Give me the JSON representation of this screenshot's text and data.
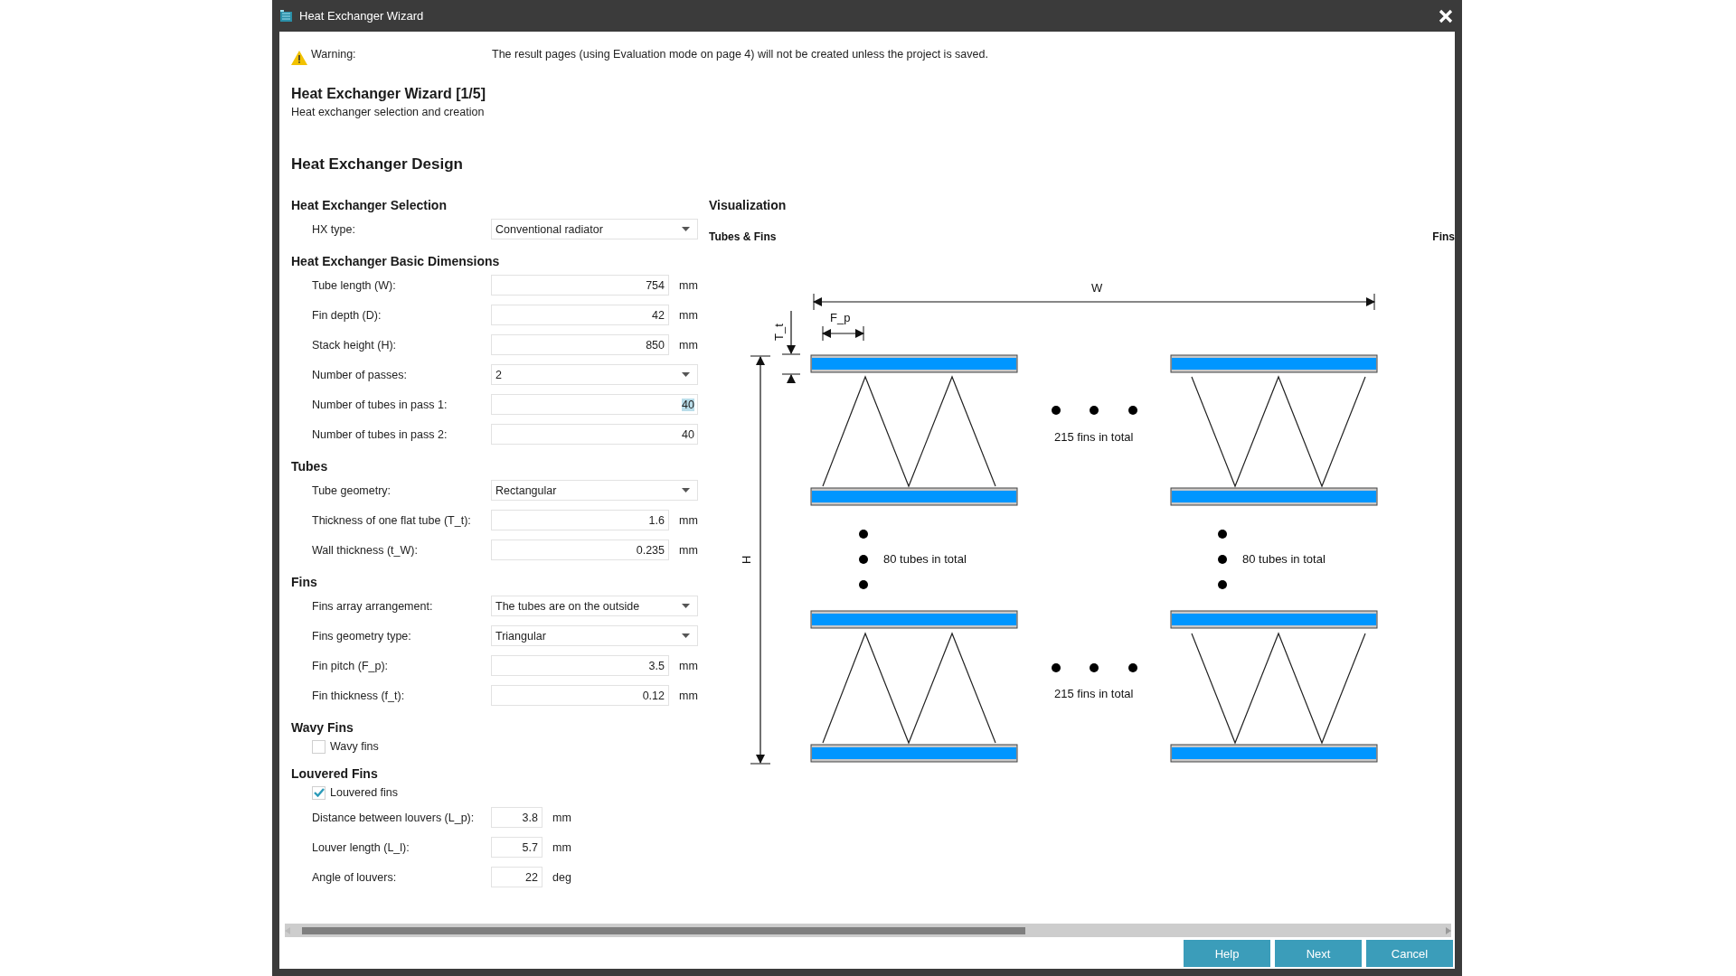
{
  "window": {
    "title": "Heat Exchanger Wizard"
  },
  "warning": {
    "label": "Warning:",
    "message": "The result pages (using Evaluation mode on page 4) will not be created unless the project is saved."
  },
  "wizard": {
    "title": "Heat Exchanger Wizard [1/5]",
    "subtitle": "Heat exchanger selection and creation"
  },
  "page_heading": "Heat Exchanger Design",
  "sections": [
    {
      "heading": "Heat Exchanger Selection",
      "rows": [
        {
          "kind": "dropdown",
          "label": "HX type:",
          "value": "Conventional radiator"
        }
      ]
    },
    {
      "heading": "Heat Exchanger Basic Dimensions",
      "rows": [
        {
          "kind": "number",
          "label": "Tube length (W):",
          "value": "754",
          "unit": "mm"
        },
        {
          "kind": "number",
          "label": "Fin depth (D):",
          "value": "42",
          "unit": "mm"
        },
        {
          "kind": "number",
          "label": "Stack height (H):",
          "value": "850",
          "unit": "mm"
        },
        {
          "kind": "dropdown",
          "label": "Number of passes:",
          "value": "2"
        },
        {
          "kind": "count",
          "label": "Number of tubes in pass 1:",
          "value": "40",
          "text_selected": true
        },
        {
          "kind": "count",
          "label": "Number of tubes in pass 2:",
          "value": "40",
          "text_selected": false
        }
      ]
    },
    {
      "heading": "Tubes",
      "rows": [
        {
          "kind": "dropdown",
          "label": "Tube geometry:",
          "value": "Rectangular"
        },
        {
          "kind": "number",
          "label": "Thickness of one flat tube (T_t):",
          "value": "1.6",
          "unit": "mm"
        },
        {
          "kind": "number",
          "label": "Wall thickness (t_W):",
          "value": "0.235",
          "unit": "mm"
        }
      ]
    },
    {
      "heading": "Fins",
      "rows": [
        {
          "kind": "dropdown",
          "label": "Fins array arrangement:",
          "value": "The tubes are on the outside"
        },
        {
          "kind": "dropdown",
          "label": "Fins geometry type:",
          "value": "Triangular"
        },
        {
          "kind": "number",
          "label": "Fin pitch (F_p):",
          "value": "3.5",
          "unit": "mm"
        },
        {
          "kind": "number",
          "label": "Fin thickness (f_t):",
          "value": "0.12",
          "unit": "mm"
        }
      ]
    },
    {
      "heading": "Wavy Fins",
      "rows": [
        {
          "kind": "checkbox",
          "label": "Wavy fins",
          "checked": false
        }
      ]
    },
    {
      "heading": "Louvered Fins",
      "rows": [
        {
          "kind": "checkbox",
          "label": "Louvered fins",
          "checked": true
        },
        {
          "kind": "short_number",
          "label": "Distance between louvers (L_p):",
          "value": "3.8",
          "unit": "mm"
        },
        {
          "kind": "short_number",
          "label": "Louver length (L_l):",
          "value": "5.7",
          "unit": "mm"
        },
        {
          "kind": "short_number",
          "label": "Angle of louvers:",
          "value": "22",
          "unit": "deg"
        }
      ]
    }
  ],
  "visualization": {
    "heading": "Visualization",
    "panels": [
      {
        "title": "Tubes & Fins"
      },
      {
        "title": "Fins"
      }
    ],
    "diagram": {
      "width_label": "W",
      "pitch_label": "F_p",
      "thickness_label": "T_t",
      "height_label": "H",
      "fins_notes": [
        "215 fins in total",
        "215 fins in total"
      ],
      "tubes_notes": [
        "80 tubes in total",
        "80 tubes in total"
      ]
    }
  },
  "buttons": [
    {
      "label": "Help"
    },
    {
      "label": "Next"
    },
    {
      "label": "Cancel"
    }
  ]
}
